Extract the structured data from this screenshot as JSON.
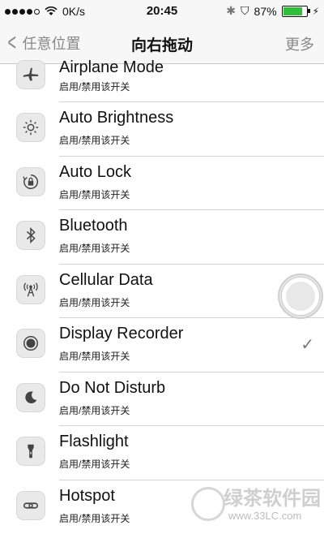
{
  "status_bar": {
    "carrier": "0K/s",
    "time": "20:45",
    "battery": "87%"
  },
  "nav": {
    "back_label": "任意位置",
    "title": "向右拖动",
    "more_label": "更多"
  },
  "rows": [
    {
      "name": "Airplane Mode",
      "sub": "启用/禁用该开关",
      "icon": "airplane-icon"
    },
    {
      "name": "Auto Brightness",
      "sub": "启用/禁用该开关",
      "icon": "sun-icon"
    },
    {
      "name": "Auto Lock",
      "sub": "启用/禁用该开关",
      "icon": "lock-rotation-icon"
    },
    {
      "name": "Bluetooth",
      "sub": "启用/禁用该开关",
      "icon": "bluetooth-icon"
    },
    {
      "name": "Cellular Data",
      "sub": "启用/禁用该开关",
      "icon": "antenna-icon"
    },
    {
      "name": "Display Recorder",
      "sub": "启用/禁用该开关",
      "icon": "record-icon",
      "checked": true
    },
    {
      "name": "Do Not Disturb",
      "sub": "启用/禁用该开关",
      "icon": "moon-icon"
    },
    {
      "name": "Flashlight",
      "sub": "启用/禁用该开关",
      "icon": "flashlight-icon"
    },
    {
      "name": "Hotspot",
      "sub": "启用/禁用该开关",
      "icon": "hotspot-icon"
    }
  ],
  "watermark": {
    "brand": "绿茶软件园",
    "url": "www.33LC.com"
  }
}
